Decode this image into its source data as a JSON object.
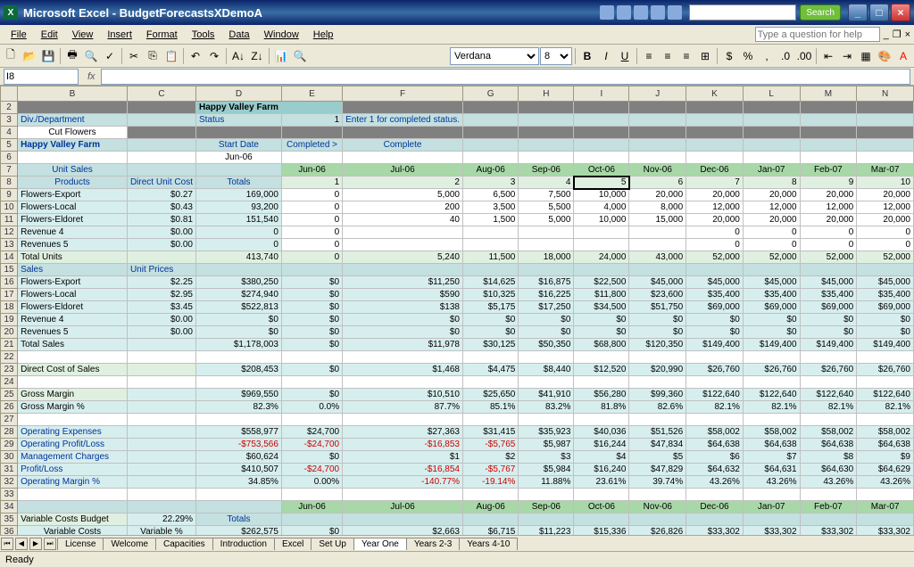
{
  "app": {
    "name": "Microsoft Excel",
    "document": "BudgetForecastsXDemoA"
  },
  "search": {
    "placeholder": "",
    "button": "Search"
  },
  "menus": [
    "File",
    "Edit",
    "View",
    "Insert",
    "Format",
    "Tools",
    "Data",
    "Window",
    "Help"
  ],
  "help_placeholder": "Type a question for help",
  "font": {
    "name": "Verdana",
    "size": "8"
  },
  "namebox": "I8",
  "status": "Ready",
  "cols": [
    "A",
    "B",
    "C",
    "D",
    "E",
    "F",
    "G",
    "H",
    "I",
    "J",
    "K",
    "L",
    "M",
    "N"
  ],
  "months": [
    "Jun-06",
    "Jul-06",
    "Aug-06",
    "Sep-06",
    "Oct-06",
    "Nov-06",
    "Dec-06",
    "Jan-07",
    "Feb-07",
    "Mar-07"
  ],
  "idx": [
    "1",
    "2",
    "3",
    "4",
    "5",
    "6",
    "7",
    "8",
    "9",
    "10"
  ],
  "hdr": {
    "farm": "Happy Valley Farm",
    "div_label": "Div./Department",
    "status_label": "Status",
    "status_val": "1",
    "status_msg": "Enter 1 for completed status.",
    "cut_flowers": "Cut Flowers",
    "farm2": "Happy Valley Farm",
    "start_date": "Start Date",
    "completed": "Completed >",
    "complete": "Complete",
    "jun06": "Jun-06",
    "unit_sales": "Unit Sales",
    "products": "Products",
    "direct_unit_cost": "Direct Unit Cost",
    "totals": "Totals"
  },
  "rows": {
    "fe": {
      "name": "Flowers-Export",
      "cost": "$0.27",
      "total": "169,000",
      "v": [
        "0",
        "5,000",
        "6,500",
        "7,500",
        "10,000",
        "20,000",
        "20,000",
        "20,000",
        "20,000",
        "20,000"
      ]
    },
    "fl": {
      "name": "Flowers-Local",
      "cost": "$0.43",
      "total": "93,200",
      "v": [
        "0",
        "200",
        "3,500",
        "5,500",
        "4,000",
        "8,000",
        "12,000",
        "12,000",
        "12,000",
        "12,000"
      ]
    },
    "fd": {
      "name": "Flowers-Eldoret",
      "cost": "$0.81",
      "total": "151,540",
      "v": [
        "0",
        "40",
        "1,500",
        "5,000",
        "10,000",
        "15,000",
        "20,000",
        "20,000",
        "20,000",
        "20,000"
      ]
    },
    "r4": {
      "name": "Revenue 4",
      "cost": "$0.00",
      "total": "0",
      "v": [
        "0",
        "",
        "",
        "",
        "",
        "",
        "0",
        "0",
        "0",
        "0"
      ]
    },
    "r5": {
      "name": "Revenues 5",
      "cost": "$0.00",
      "total": "0",
      "v": [
        "0",
        "",
        "",
        "",
        "",
        "",
        "0",
        "0",
        "0",
        "0"
      ]
    },
    "tu": {
      "name": "Total Units",
      "total": "413,740",
      "v": [
        "0",
        "5,240",
        "11,500",
        "18,000",
        "24,000",
        "43,000",
        "52,000",
        "52,000",
        "52,000",
        "52,000"
      ]
    },
    "sales": {
      "name": "Sales",
      "sub": "Unit Prices"
    },
    "sfe": {
      "name": "Flowers-Export",
      "price": "$2.25",
      "total": "$380,250",
      "v": [
        "$0",
        "$11,250",
        "$14,625",
        "$16,875",
        "$22,500",
        "$45,000",
        "$45,000",
        "$45,000",
        "$45,000",
        "$45,000"
      ]
    },
    "sfl": {
      "name": "Flowers-Local",
      "price": "$2.95",
      "total": "$274,940",
      "v": [
        "$0",
        "$590",
        "$10,325",
        "$16,225",
        "$11,800",
        "$23,600",
        "$35,400",
        "$35,400",
        "$35,400",
        "$35,400"
      ]
    },
    "sfd": {
      "name": "Flowers-Eldoret",
      "price": "$3.45",
      "total": "$522,813",
      "v": [
        "$0",
        "$138",
        "$5,175",
        "$17,250",
        "$34,500",
        "$51,750",
        "$69,000",
        "$69,000",
        "$69,000",
        "$69,000"
      ]
    },
    "sr4": {
      "name": "Revenue 4",
      "price": "$0.00",
      "total": "$0",
      "v": [
        "$0",
        "$0",
        "$0",
        "$0",
        "$0",
        "$0",
        "$0",
        "$0",
        "$0",
        "$0"
      ]
    },
    "sr5": {
      "name": "Revenues 5",
      "price": "$0.00",
      "total": "$0",
      "v": [
        "$0",
        "$0",
        "$0",
        "$0",
        "$0",
        "$0",
        "$0",
        "$0",
        "$0",
        "$0"
      ]
    },
    "ts": {
      "name": "Total Sales",
      "total": "$1,178,003",
      "v": [
        "$0",
        "$11,978",
        "$30,125",
        "$50,350",
        "$68,800",
        "$120,350",
        "$149,400",
        "$149,400",
        "$149,400",
        "$149,400"
      ]
    },
    "dcos": {
      "name": "Direct Cost of Sales",
      "total": "$208,453",
      "v": [
        "$0",
        "$1,468",
        "$4,475",
        "$8,440",
        "$12,520",
        "$20,990",
        "$26,760",
        "$26,760",
        "$26,760",
        "$26,760"
      ]
    },
    "gm": {
      "name": "Gross Margin",
      "total": "$969,550",
      "v": [
        "$0",
        "$10,510",
        "$25,650",
        "$41,910",
        "$56,280",
        "$99,360",
        "$122,640",
        "$122,640",
        "$122,640",
        "$122,640"
      ]
    },
    "gmp": {
      "name": "Gross Margin %",
      "total": "82.3%",
      "v": [
        "0.0%",
        "87.7%",
        "85.1%",
        "83.2%",
        "81.8%",
        "82.6%",
        "82.1%",
        "82.1%",
        "82.1%",
        "82.1%"
      ]
    },
    "oe": {
      "name": "Operating Expenses",
      "total": "$558,977",
      "v": [
        "$24,700",
        "$27,363",
        "$31,415",
        "$35,923",
        "$40,036",
        "$51,526",
        "$58,002",
        "$58,002",
        "$58,002",
        "$58,002"
      ]
    },
    "opl": {
      "name": "Operating Profit/Loss",
      "total": "-$753,566",
      "v": [
        "-$24,700",
        "-$16,853",
        "-$5,765",
        "$5,987",
        "$16,244",
        "$47,834",
        "$64,638",
        "$64,638",
        "$64,638",
        "$64,638"
      ]
    },
    "mc": {
      "name": "Management Charges",
      "total": "$60,624",
      "v": [
        "$0",
        "$1",
        "$2",
        "$3",
        "$4",
        "$5",
        "$6",
        "$7",
        "$8",
        "$9"
      ]
    },
    "pl": {
      "name": "Profit/Loss",
      "total": "$410,507",
      "v": [
        "-$24,700",
        "-$16,854",
        "-$5,767",
        "$5,984",
        "$16,240",
        "$47,829",
        "$64,632",
        "$64,631",
        "$64,630",
        "$64,629"
      ]
    },
    "omp": {
      "name": "Operating Margin %",
      "total": "34.85%",
      "v": [
        "0.00%",
        "-140.77%",
        "-19.14%",
        "11.88%",
        "23.61%",
        "39.74%",
        "43.26%",
        "43.26%",
        "43.26%",
        "43.26%"
      ]
    },
    "vcb": {
      "name": "Variable Costs Budget",
      "pct": "22.29%",
      "total": "Totals"
    },
    "vc": {
      "name": "Variable Costs",
      "pct": "Variable %",
      "total": "$262,575",
      "v": [
        "$0",
        "$2,663",
        "$6,715",
        "$11,223",
        "$15,336",
        "$26,826",
        "$33,302",
        "$33,302",
        "$33,302",
        "$33,302"
      ]
    }
  },
  "tabs": [
    "License",
    "Welcome",
    "Capacities",
    "Introduction",
    "Excel",
    "Set Up",
    "Year One",
    "Years 2-3",
    "Years 4-10"
  ],
  "active_tab": "Year One"
}
